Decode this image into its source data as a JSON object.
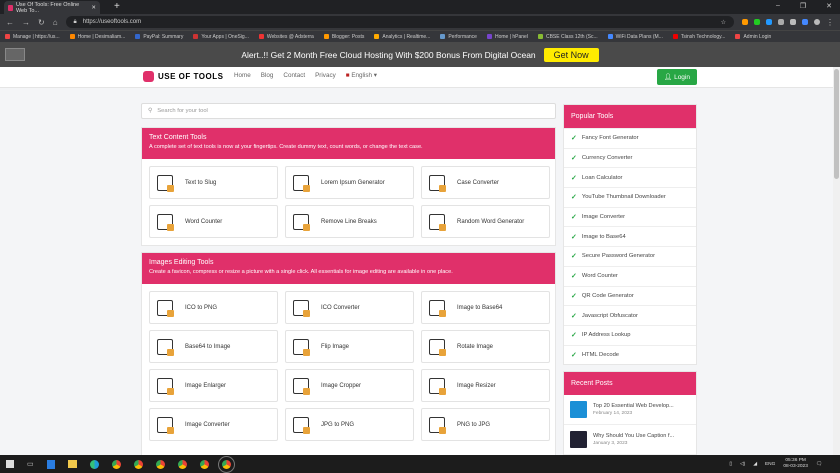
{
  "browser": {
    "tab_title": "Use Of Tools: Free Online Web To...",
    "url": "https://useoftools.com",
    "bookmarks": [
      "Manage | https://us...",
      "Home | Desimaliam...",
      "PayPal: Summary",
      "Your Apps | OneSig...",
      "Websites @ Adsterra",
      "Blogger: Posts",
      "Analytics | Realtime...",
      "Performance",
      "Home | hPanel",
      "CBSE Class 12th (Sc...",
      "WiFi Data Plans (M...",
      "Tsinsh Technology...",
      "Admin Login"
    ]
  },
  "banner": {
    "text": "Alert..!! Get 2 Month Free Cloud Hosting With $200 Bonus From Digital Ocean",
    "button": "Get Now"
  },
  "nav": {
    "brand": "USE OF TOOLS",
    "links": [
      "Home",
      "Blog",
      "Contact",
      "Privacy",
      "English"
    ],
    "login": "Login"
  },
  "search": {
    "placeholder": "Search for your tool"
  },
  "text_tools": {
    "title": "Text Content Tools",
    "desc": "A complete set of text tools is now at your fingertips. Create dummy text, count words, or change the text case.",
    "items": [
      "Text to Slug",
      "Lorem Ipsum Generator",
      "Case Converter",
      "Word Counter",
      "Remove Line Breaks",
      "Random Word Generator"
    ]
  },
  "image_tools": {
    "title": "Images Editing Tools",
    "desc": "Create a favicon, compress or resize a picture with a single click. All essentials for image editing are available in one place.",
    "items": [
      "ICO to PNG",
      "ICO Converter",
      "Image to Base64",
      "Base64 to Image",
      "Flip Image",
      "Rotate Image",
      "Image Enlarger",
      "Image Cropper",
      "Image Resizer",
      "Image Converter",
      "JPG to PNG",
      "PNG to JPG"
    ]
  },
  "popular": {
    "title": "Popular Tools",
    "items": [
      "Fancy Font Generator",
      "Currency Converter",
      "Loan Calculator",
      "YouTube Thumbnail Downloader",
      "Image Converter",
      "Image to Base64",
      "Secure Password Generator",
      "Word Counter",
      "QR Code Generator",
      "Javascript Obfuscator",
      "IP Address Lookup",
      "HTML Decode"
    ]
  },
  "recent": {
    "title": "Recent Posts",
    "posts": [
      {
        "title": "Top 20 Essential Web Develop...",
        "date": "February 14, 2023"
      },
      {
        "title": "Why Should You Use Caption f...",
        "date": "January 3, 2023"
      }
    ]
  },
  "taskbar": {
    "lang": "ENG",
    "time": "05:36 PM",
    "date": "08-03-2023"
  },
  "colors": {
    "accent": "#e0306a",
    "green": "#28a745",
    "yellow": "#ffeb00"
  }
}
